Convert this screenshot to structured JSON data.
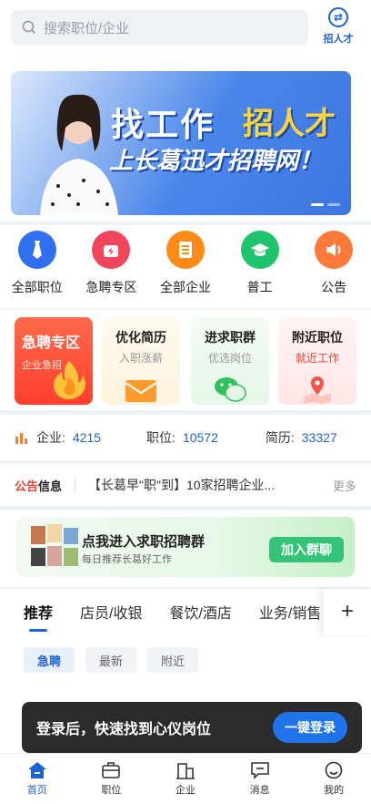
{
  "search": {
    "placeholder": "搜索职位/企业"
  },
  "header": {
    "hire_label": "招人才"
  },
  "banner": {
    "line1": "找工作",
    "line2": "招人才",
    "line3": "上长葛迅才招聘网！"
  },
  "quick_menu": [
    {
      "label": "全部职位",
      "icon": "tie-icon",
      "color": "#2f6ff0"
    },
    {
      "label": "急聘专区",
      "icon": "urgent-icon",
      "color": "#f0455a"
    },
    {
      "label": "全部企业",
      "icon": "building-icon",
      "color": "#ff8a18"
    },
    {
      "label": "普工",
      "icon": "graduation-cap-icon",
      "color": "#1fc36a"
    },
    {
      "label": "公告",
      "icon": "speaker-icon",
      "color": "#ff7a3a"
    }
  ],
  "feature_cards": {
    "urgent": {
      "title": "急聘专区",
      "subtitle": "企业急招"
    },
    "resume": {
      "title": "优化简历",
      "subtitle": "入职涨薪"
    },
    "group": {
      "title": "进求职群",
      "subtitle": "优选岗位"
    },
    "nearby": {
      "title": "附近职位",
      "subtitle": "就近工作"
    }
  },
  "stats": [
    {
      "label": "企业:",
      "value": "4215"
    },
    {
      "label": "职位:",
      "value": "10572"
    },
    {
      "label": "简历:",
      "value": "33327"
    }
  ],
  "notice": {
    "label_a": "公告",
    "label_b": "信息",
    "text": "【长葛早\"职\"到】10家招聘企业...",
    "more": "更多"
  },
  "join_group": {
    "title": "点我进入求职招聘群",
    "subtitle": "每日推荐长葛好工作",
    "button": "加入群聊"
  },
  "tabs": [
    {
      "label": "推荐",
      "active": true
    },
    {
      "label": "店员/收银",
      "active": false
    },
    {
      "label": "餐饮/酒店",
      "active": false
    },
    {
      "label": "业务/销售",
      "active": false
    }
  ],
  "filters": [
    {
      "label": "急聘",
      "active": true
    },
    {
      "label": "最新",
      "active": false
    },
    {
      "label": "附近",
      "active": false
    }
  ],
  "login_toast": {
    "text": "登录后，快速找到心仪岗位",
    "button": "一键登录"
  },
  "bottom_nav": [
    {
      "label": "首页",
      "icon": "home-icon",
      "active": true
    },
    {
      "label": "职位",
      "icon": "briefcase-icon",
      "active": false
    },
    {
      "label": "企业",
      "icon": "company-icon",
      "active": false
    },
    {
      "label": "消息",
      "icon": "message-icon",
      "active": false
    },
    {
      "label": "我的",
      "icon": "profile-icon",
      "active": false
    }
  ],
  "colors": {
    "primary": "#1e63d6",
    "accent_red": "#e8432e",
    "group_green": "#37c27a"
  }
}
